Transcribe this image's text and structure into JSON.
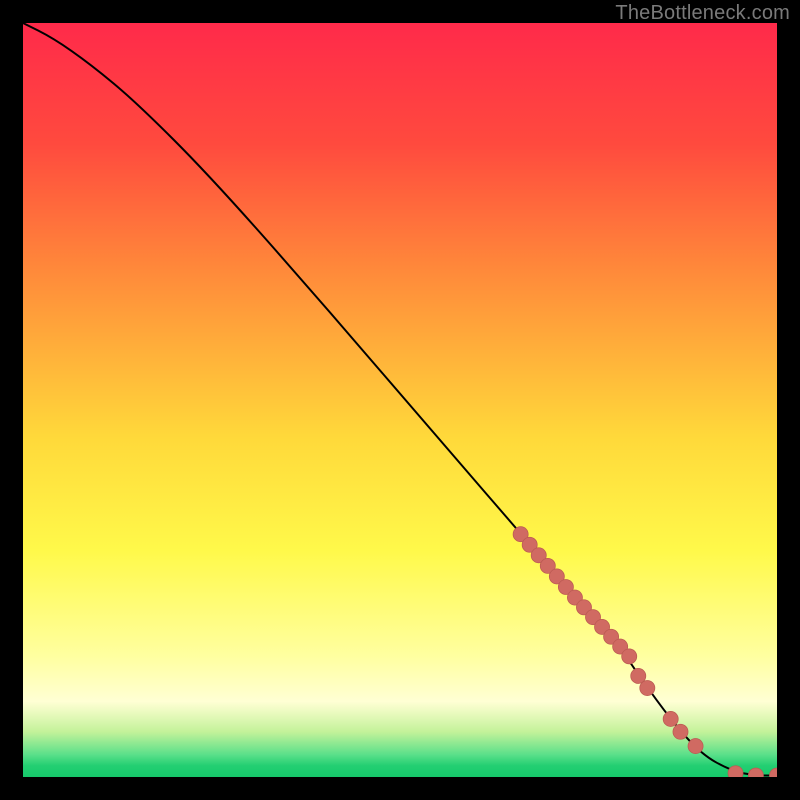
{
  "attribution": "TheBottleneck.com",
  "colors": {
    "bg_black": "#000000",
    "grad_top": "#ff2a4a",
    "grad_mid1": "#ff8a3a",
    "grad_mid2": "#ffd93a",
    "grad_yellow": "#fff94a",
    "grad_pale": "#ffffb0",
    "grad_green_light": "#a6f27b",
    "grad_green": "#2cd67a",
    "grad_green_bottom": "#16c96b",
    "curve": "#000000",
    "marker_fill": "#d06a62",
    "marker_stroke": "#bb5a52"
  },
  "chart_data": {
    "type": "line",
    "title": "",
    "xlabel": "",
    "ylabel": "",
    "xlim": [
      0,
      1000
    ],
    "ylim": [
      0,
      1000
    ],
    "curve": {
      "name": "bottleneck-curve",
      "x": [
        0,
        40,
        90,
        150,
        250,
        400,
        550,
        680,
        760,
        800,
        820,
        860,
        900,
        940,
        970,
        1000
      ],
      "y": [
        1000,
        980,
        945,
        895,
        795,
        625,
        450,
        300,
        205,
        160,
        130,
        75,
        30,
        8,
        2,
        2
      ]
    },
    "markers": {
      "name": "data-points",
      "x": [
        660,
        672,
        684,
        696,
        708,
        720,
        732,
        744,
        756,
        768,
        780,
        792,
        804,
        816,
        828,
        859,
        872,
        892,
        945,
        972,
        1000
      ],
      "y": [
        322,
        308,
        294,
        280,
        266,
        252,
        238,
        225,
        212,
        199,
        186,
        173,
        160,
        134,
        118,
        77,
        60,
        41,
        5,
        2,
        2
      ],
      "r": 10
    },
    "gradient_stops": [
      {
        "offset": 0.0,
        "color": "#ff2a4a"
      },
      {
        "offset": 0.16,
        "color": "#ff4a3e"
      },
      {
        "offset": 0.33,
        "color": "#ff8a3a"
      },
      {
        "offset": 0.55,
        "color": "#ffd93a"
      },
      {
        "offset": 0.7,
        "color": "#fff94a"
      },
      {
        "offset": 0.84,
        "color": "#ffffa0"
      },
      {
        "offset": 0.9,
        "color": "#ffffd4"
      },
      {
        "offset": 0.94,
        "color": "#c4f29a"
      },
      {
        "offset": 0.97,
        "color": "#5ce08a"
      },
      {
        "offset": 0.985,
        "color": "#23cf72"
      },
      {
        "offset": 1.0,
        "color": "#16c96b"
      }
    ]
  }
}
